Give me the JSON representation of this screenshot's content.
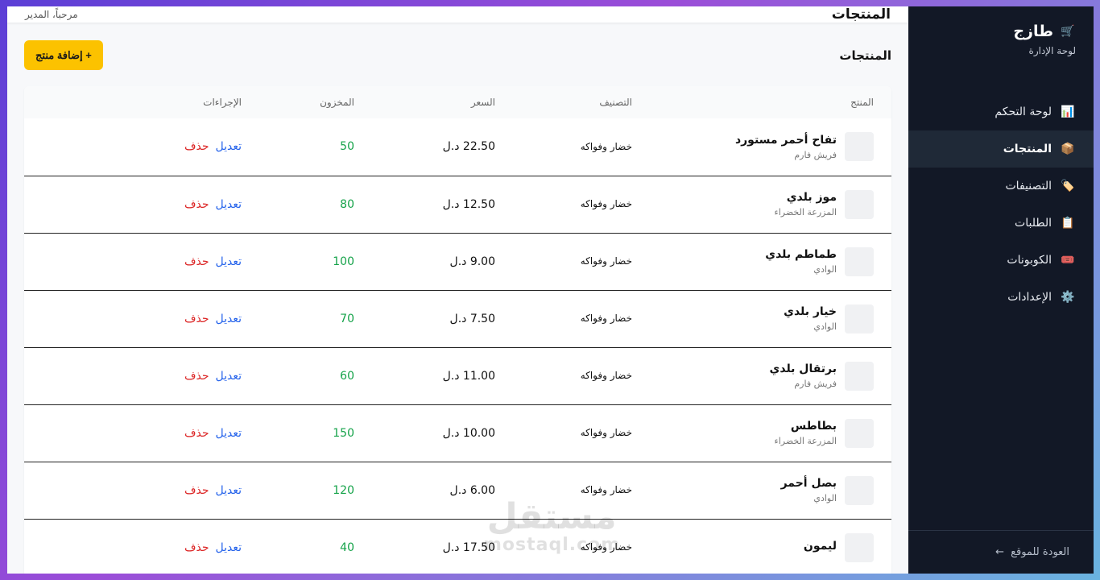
{
  "sidebar": {
    "brand_title": "طازج",
    "brand_icon": "cart-icon",
    "brand_subtitle": "لوحة الإدارة",
    "items": [
      {
        "label": "لوحة التحكم",
        "icon": "chart-icon",
        "glyph": "📊"
      },
      {
        "label": "المنتجات",
        "icon": "package-icon",
        "glyph": "📦",
        "active": true
      },
      {
        "label": "التصنيفات",
        "icon": "tag-icon",
        "glyph": "🏷️"
      },
      {
        "label": "الطلبات",
        "icon": "clipboard-icon",
        "glyph": "📋"
      },
      {
        "label": "الكوبونات",
        "icon": "ticket-icon",
        "glyph": "🎟️"
      },
      {
        "label": "الإعدادات",
        "icon": "gear-icon",
        "glyph": "⚙️"
      }
    ],
    "footer_label": "العودة للموقع",
    "footer_arrow": "←"
  },
  "topbar": {
    "title": "المنتجات",
    "welcome": "مرحباً، المدير"
  },
  "main": {
    "section_title": "المنتجات",
    "add_button": "+ إضافة منتج"
  },
  "table": {
    "headers": [
      "المنتج",
      "التصنيف",
      "السعر",
      "المخزون",
      "الإجراءات"
    ],
    "rows": [
      {
        "name": "تفاح أحمر مستورد",
        "supplier": "فريش فارم",
        "category": "خضار وفواكه",
        "price": "22.50 د.ل",
        "stock": "50",
        "edit": "تعديل",
        "delete": "حذف"
      },
      {
        "name": "موز بلدي",
        "supplier": "المزرعة الخضراء",
        "category": "خضار وفواكه",
        "price": "12.50 د.ل",
        "stock": "80",
        "edit": "تعديل",
        "delete": "حذف"
      },
      {
        "name": "طماطم بلدي",
        "supplier": "الوادي",
        "category": "خضار وفواكه",
        "price": "9.00 د.ل",
        "stock": "100",
        "edit": "تعديل",
        "delete": "حذف"
      },
      {
        "name": "خيار بلدي",
        "supplier": "الوادي",
        "category": "خضار وفواكه",
        "price": "7.50 د.ل",
        "stock": "70",
        "edit": "تعديل",
        "delete": "حذف"
      },
      {
        "name": "برتقال بلدي",
        "supplier": "فريش فارم",
        "category": "خضار وفواكه",
        "price": "11.00 د.ل",
        "stock": "60",
        "edit": "تعديل",
        "delete": "حذف"
      },
      {
        "name": "بطاطس",
        "supplier": "المزرعة الخضراء",
        "category": "خضار وفواكه",
        "price": "10.00 د.ل",
        "stock": "150",
        "edit": "تعديل",
        "delete": "حذف"
      },
      {
        "name": "بصل أحمر",
        "supplier": "الوادي",
        "category": "خضار وفواكه",
        "price": "6.00 د.ل",
        "stock": "120",
        "edit": "تعديل",
        "delete": "حذف"
      },
      {
        "name": "ليمون",
        "supplier": "",
        "category": "خضار وفواكه",
        "price": "17.50 د.ل",
        "stock": "40",
        "edit": "تعديل",
        "delete": "حذف"
      }
    ]
  },
  "watermark": {
    "arabic": "مستقل",
    "latin": "mostaql.com"
  },
  "colors": {
    "sidebar_bg": "#121826",
    "accent_button": "#fcc200",
    "stock_green": "#16a34a",
    "edit_blue": "#2563eb",
    "delete_red": "#dc2626"
  }
}
